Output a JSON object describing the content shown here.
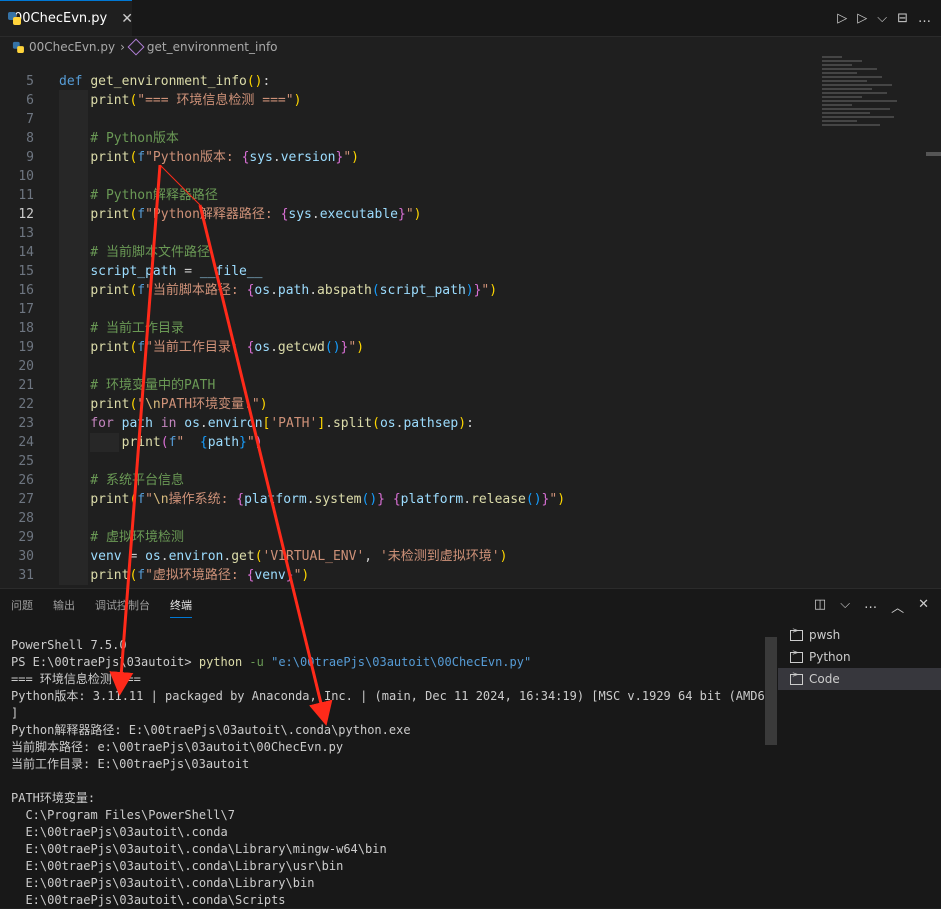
{
  "tab": {
    "label": "00ChecEvn.py",
    "close": "✕"
  },
  "toolbar": {
    "run": "▷",
    "run_debug": "▷",
    "chevron": "⌵",
    "split": "⊟",
    "more": "…"
  },
  "breadcrumb": {
    "file": "00ChecEvn.py",
    "sep": "›",
    "symbol": "get_environment_info"
  },
  "editor": {
    "lines": [
      {
        "n": "5",
        "text": "def get_environment_info():"
      },
      {
        "n": "6",
        "text": "    print(\"=== 环境信息检测 ===\")"
      },
      {
        "n": "7",
        "text": ""
      },
      {
        "n": "8",
        "text": "    # Python版本"
      },
      {
        "n": "9",
        "text": "    print(f\"Python版本: {sys.version}\")"
      },
      {
        "n": "10",
        "text": ""
      },
      {
        "n": "11",
        "text": "    # Python解释器路径"
      },
      {
        "n": "12",
        "text": "    print(f\"Python解释器路径: {sys.executable}\")"
      },
      {
        "n": "13",
        "text": ""
      },
      {
        "n": "14",
        "text": "    # 当前脚本文件路径"
      },
      {
        "n": "15",
        "text": "    script_path = __file__"
      },
      {
        "n": "16",
        "text": "    print(f\"当前脚本路径: {os.path.abspath(script_path)}\")"
      },
      {
        "n": "17",
        "text": ""
      },
      {
        "n": "18",
        "text": "    # 当前工作目录"
      },
      {
        "n": "19",
        "text": "    print(f\"当前工作目录: {os.getcwd()}\")"
      },
      {
        "n": "20",
        "text": ""
      },
      {
        "n": "21",
        "text": "    # 环境变量中的PATH"
      },
      {
        "n": "22",
        "text": "    print(\"\\nPATH环境变量:\")"
      },
      {
        "n": "23",
        "text": "    for path in os.environ['PATH'].split(os.pathsep):"
      },
      {
        "n": "24",
        "text": "        print(f\"  {path}\")"
      },
      {
        "n": "25",
        "text": ""
      },
      {
        "n": "26",
        "text": "    # 系统平台信息"
      },
      {
        "n": "27",
        "text": "    print(f\"\\n操作系统: {platform.system()} {platform.release()}\")"
      },
      {
        "n": "28",
        "text": ""
      },
      {
        "n": "29",
        "text": "    # 虚拟环境检测"
      },
      {
        "n": "30",
        "text": "    venv = os.environ.get('VIRTUAL_ENV', '未检测到虚拟环境')"
      },
      {
        "n": "31",
        "text": "    print(f\"虚拟环境路径: {venv}\")"
      }
    ]
  },
  "panel": {
    "tabs": [
      "问题",
      "输出",
      "调试控制台",
      "终端"
    ],
    "active_tab": "终端",
    "actions": {
      "split": "◫",
      "chevron": "⌵",
      "more": "…",
      "up": "︿",
      "close": "✕"
    },
    "terminal_list": [
      "pwsh",
      "Python",
      "Code"
    ],
    "terminal_selected": "Code",
    "terminal": {
      "l1": "PowerShell 7.5.0",
      "prompt": "PS E:\\00traePjs\\03autoit> ",
      "cmd": "python",
      "arg": " -u ",
      "path": "\"e:\\00traePjs\\03autoit\\00ChecEvn.py\"",
      "out": "=== 环境信息检测 ===\nPython版本: 3.11.11 | packaged by Anaconda, Inc. | (main, Dec 11 2024, 16:34:19) [MSC v.1929 64 bit (AMD64)\n]\nPython解释器路径: E:\\00traePjs\\03autoit\\.conda\\python.exe\n当前脚本路径: e:\\00traePjs\\03autoit\\00ChecEvn.py\n当前工作目录: E:\\00traePjs\\03autoit\n\nPATH环境变量:\n  C:\\Program Files\\PowerShell\\7\n  E:\\00traePjs\\03autoit\\.conda\n  E:\\00traePjs\\03autoit\\.conda\\Library\\mingw-w64\\bin\n  E:\\00traePjs\\03autoit\\.conda\\Library\\usr\\bin\n  E:\\00traePjs\\03autoit\\.conda\\Library\\bin\n  E:\\00traePjs\\03autoit\\.conda\\Scripts"
    }
  },
  "annotation_color": "#ff2a1a"
}
